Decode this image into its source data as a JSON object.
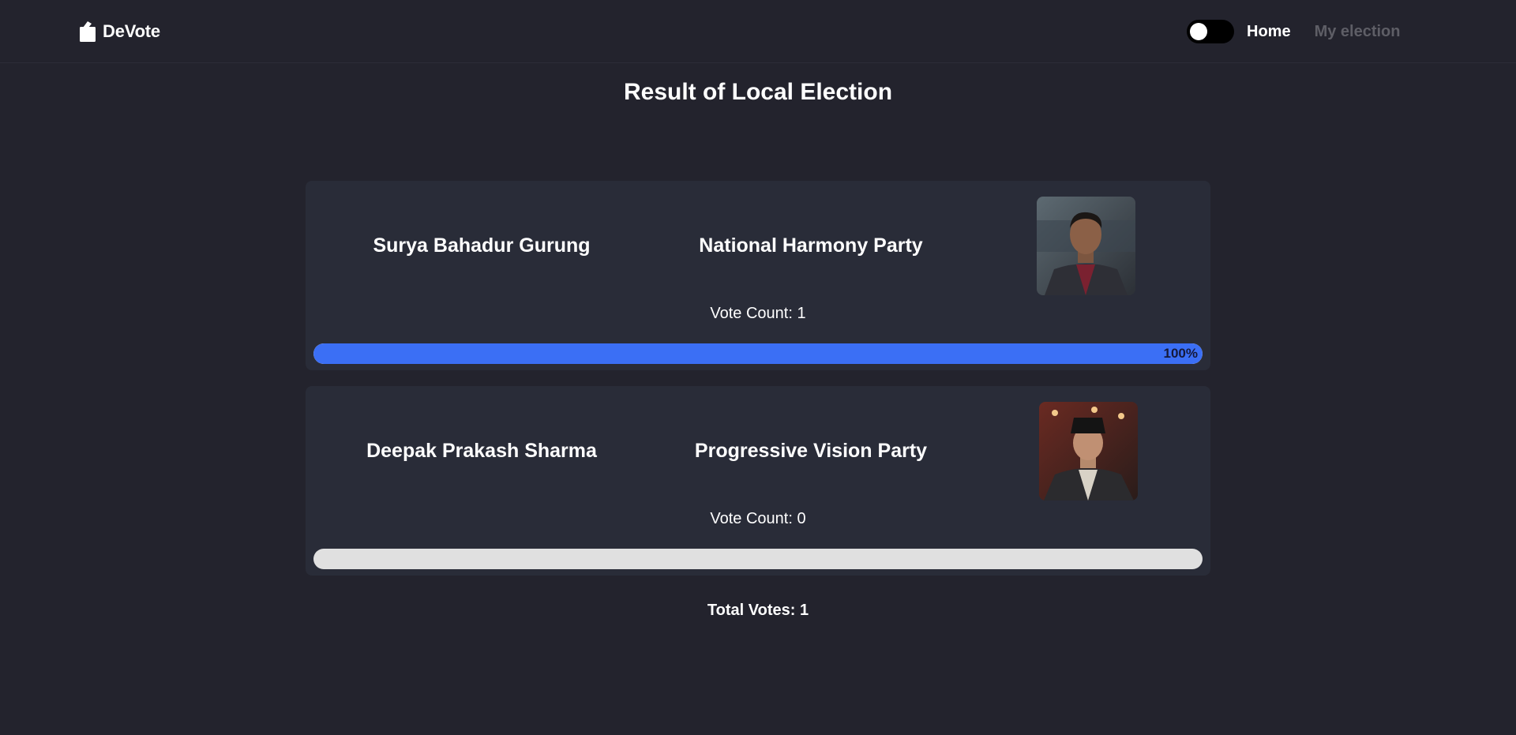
{
  "app": {
    "brand_name": "DeVote",
    "brand_icon": "ballot-box-icon"
  },
  "nav": {
    "theme_toggle": {
      "state": "off",
      "icon": "toggle-icon"
    },
    "links": [
      {
        "label": "Home",
        "active": true
      },
      {
        "label": "My election",
        "active": false
      }
    ]
  },
  "page": {
    "title": "Result of Local Election"
  },
  "candidates": [
    {
      "name": "Surya Bahadur Gurung",
      "party": "National Harmony Party",
      "photo_icon": "candidate-photo",
      "vote_count_text": "Vote Count: 1",
      "vote_count": 1,
      "percent": 100,
      "percent_label": "100%"
    },
    {
      "name": "Deepak Prakash Sharma",
      "party": "Progressive Vision Party",
      "photo_icon": "candidate-photo",
      "vote_count_text": "Vote Count: 0",
      "vote_count": 0,
      "percent": 0,
      "percent_label": ""
    }
  ],
  "summary": {
    "total_votes_text": "Total Votes: 1",
    "total_votes": 1
  },
  "colors": {
    "background": "#23232d",
    "card": "#292c38",
    "progress_fill": "#3b6ff5",
    "progress_track": "#e0e0e0",
    "nav_inactive": "#5e5e66"
  }
}
